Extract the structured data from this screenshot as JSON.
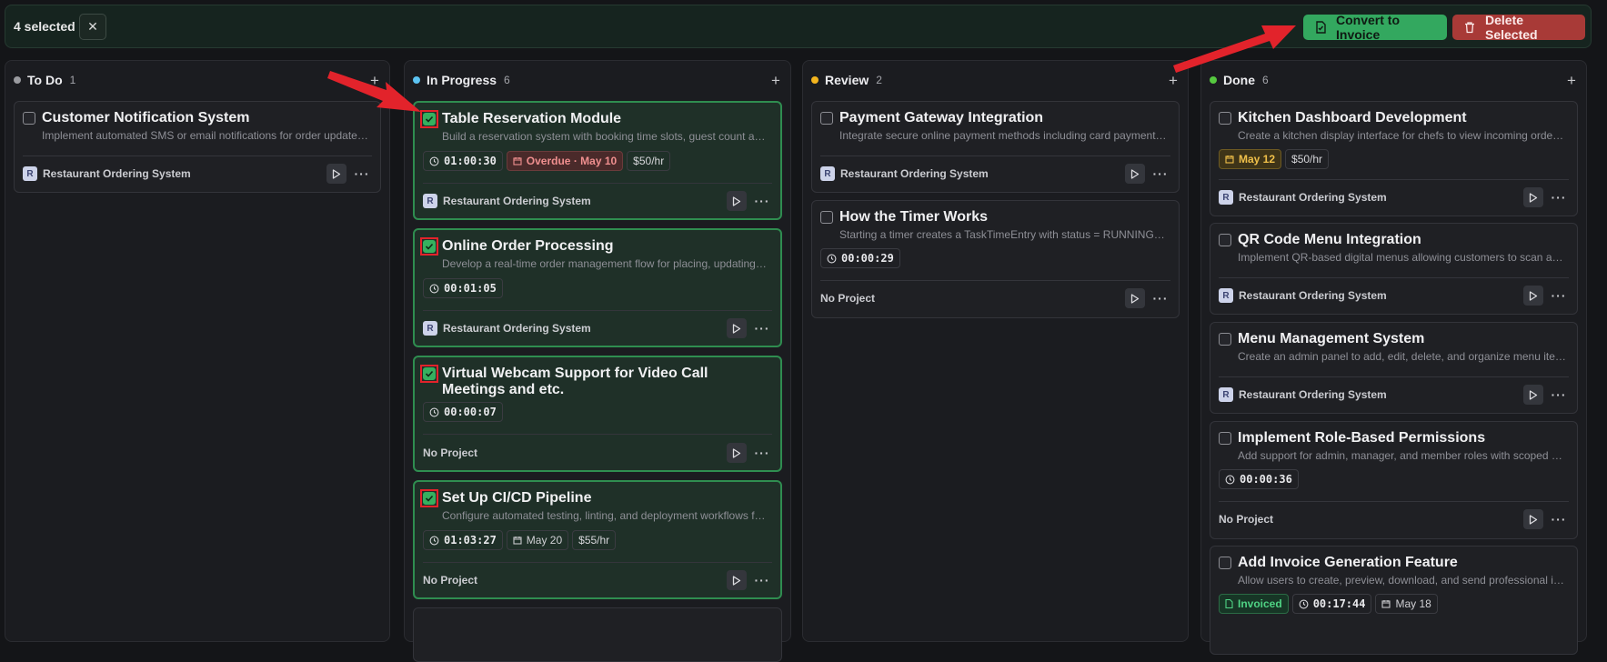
{
  "selection": {
    "count_label": "4 selected",
    "clear_icon": "close-icon",
    "convert_label": "Convert to Invoice",
    "convert_icon": "invoice-icon",
    "delete_label": "Delete Selected",
    "delete_icon": "trash-icon"
  },
  "colors": {
    "accent_green": "#33a85f",
    "danger_red": "#a83a37",
    "annotation_red": "#e2232b",
    "todo_dot": "#9a9ba0",
    "progress_dot": "#5cc3f2",
    "review_dot": "#f3b51e",
    "done_dot": "#56c93f"
  },
  "columns": [
    {
      "title": "To Do",
      "count": "1",
      "cards": [
        {
          "title": "Customer Notification System",
          "desc": "Implement automated SMS or email notifications for order updates and reservations.",
          "project": "Restaurant Ordering System",
          "badge": "R",
          "selected": false
        }
      ]
    },
    {
      "title": "In Progress",
      "count": "6",
      "cards": [
        {
          "title": "Table Reservation Module",
          "desc": "Build a reservation system with booking time slots, guest count and table assignment.",
          "time": "01:00:30",
          "due": "Overdue · May 10",
          "rate": "$50/hr",
          "project": "Restaurant Ordering System",
          "badge": "R",
          "selected": true
        },
        {
          "title": "Online Order Processing",
          "desc": "Develop a real-time order management flow for placing, updating and tracking orders.",
          "time": "00:01:05",
          "project": "Restaurant Ordering System",
          "badge": "R",
          "selected": true
        },
        {
          "title": "Virtual Webcam Support for Video Call Meetings and etc.",
          "time": "00:00:07",
          "project": "No Project",
          "selected": true
        },
        {
          "title": "Set Up CI/CD Pipeline",
          "desc": "Configure automated testing, linting, and deployment workflows for the project.",
          "time": "01:03:27",
          "due": "May 20",
          "rate": "$55/hr",
          "project": "No Project",
          "selected": true
        }
      ]
    },
    {
      "title": "Review",
      "count": "2",
      "cards": [
        {
          "title": "Payment Gateway Integration",
          "desc": "Integrate secure online payment methods including card payments and wallets.",
          "project": "Restaurant Ordering System",
          "badge": "R",
          "selected": false
        },
        {
          "title": "How the Timer Works",
          "desc": "Starting a timer creates a TaskTimeEntry with status = RUNNING and records the start time.",
          "time": "00:00:29",
          "project": "No Project",
          "selected": false
        }
      ]
    },
    {
      "title": "Done",
      "count": "6",
      "cards": [
        {
          "title": "Kitchen Dashboard Development",
          "desc": "Create a kitchen display interface for chefs to view incoming orders in real time.",
          "due": "May 12",
          "rate": "$50/hr",
          "project": "Restaurant Ordering System",
          "badge": "R",
          "selected": false
        },
        {
          "title": "QR Code Menu Integration",
          "desc": "Implement QR-based digital menus allowing customers to scan and order from their table.",
          "project": "Restaurant Ordering System",
          "badge": "R",
          "selected": false
        },
        {
          "title": "Menu Management System",
          "desc": "Create an admin panel to add, edit, delete, and organize menu items and categories.",
          "project": "Restaurant Ordering System",
          "badge": "R",
          "selected": false
        },
        {
          "title": "Implement Role-Based Permissions",
          "desc": "Add support for admin, manager, and member roles with scoped access control.",
          "time": "00:00:36",
          "project": "No Project",
          "selected": false
        },
        {
          "title": "Add Invoice Generation Feature",
          "desc": "Allow users to create, preview, download, and send professional invoices.",
          "invoiced": "Invoiced",
          "time": "00:17:44",
          "due": "May 18",
          "selected": false
        }
      ]
    }
  ]
}
